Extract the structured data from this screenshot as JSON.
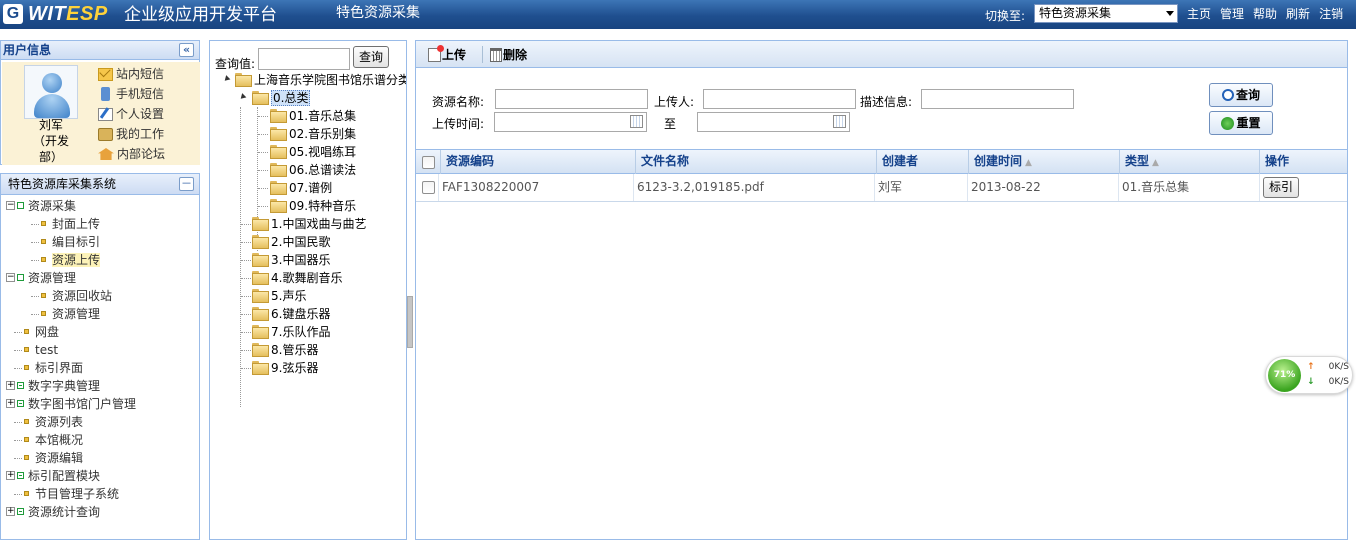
{
  "header": {
    "logo_letter": "G",
    "brand_part1": "WIT",
    "brand_part2": "ESP",
    "app_title": "企业级应用开发平台",
    "module_title": "特色资源采集",
    "switch_label": "切换至:",
    "switch_value": "特色资源采集",
    "nav": [
      "主页",
      "管理",
      "帮助",
      "刷新",
      "注销"
    ]
  },
  "user_panel": {
    "title": "用户信息",
    "collapse_icon": "«",
    "user_name": "刘军",
    "user_dept_line1": "（开发",
    "user_dept_line2": "部）",
    "menu": [
      {
        "label": "站内短信",
        "icon": "mail-icon"
      },
      {
        "label": "手机短信",
        "icon": "phone-icon"
      },
      {
        "label": "个人设置",
        "icon": "edit-icon"
      },
      {
        "label": "我的工作",
        "icon": "work-icon"
      },
      {
        "label": "内部论坛",
        "icon": "forum-icon"
      }
    ]
  },
  "nav_panel": {
    "title": "特色资源库采集系统",
    "collapse_icon": "－",
    "items": [
      {
        "label": "资源采集",
        "level": 0,
        "toggle": "−",
        "selected": false
      },
      {
        "label": "封面上传",
        "level": 1,
        "selected": false
      },
      {
        "label": "编目标引",
        "level": 1,
        "selected": false
      },
      {
        "label": "资源上传",
        "level": 1,
        "selected": true
      },
      {
        "label": "资源管理",
        "level": 0,
        "toggle": "−",
        "selected": false
      },
      {
        "label": "资源回收站",
        "level": 1,
        "selected": false
      },
      {
        "label": "资源管理",
        "level": 1,
        "selected": false
      },
      {
        "label": "网盘",
        "level": 0,
        "selected": false
      },
      {
        "label": "test",
        "level": 0,
        "selected": false
      },
      {
        "label": "标引界面",
        "level": 0,
        "selected": false
      },
      {
        "label": "数字字典管理",
        "level": 0,
        "toggle": "+",
        "selected": false
      },
      {
        "label": "数字图书馆门户管理",
        "level": 0,
        "toggle": "+",
        "selected": false
      },
      {
        "label": "资源列表",
        "level": 0,
        "selected": false
      },
      {
        "label": "本馆概况",
        "level": 0,
        "selected": false
      },
      {
        "label": "资源编辑",
        "level": 0,
        "selected": false
      },
      {
        "label": "标引配置模块",
        "level": 0,
        "toggle": "+",
        "selected": false
      },
      {
        "label": "节目管理子系统",
        "level": 0,
        "selected": false
      },
      {
        "label": "资源统计查询",
        "level": 0,
        "toggle": "+",
        "selected": false
      }
    ]
  },
  "category_tree": {
    "query_label": "查询值:",
    "query_value": "",
    "query_button": "查询",
    "root": "上海音乐学院图书馆乐谱分类",
    "selected": "0.总类",
    "children_of_selected": [
      "01.音乐总集",
      "02.音乐别集",
      "05.视唱练耳",
      "06.总谱读法",
      "07.谱例",
      "09.特种音乐"
    ],
    "siblings": [
      "1.中国戏曲与曲艺",
      "2.中国民歌",
      "3.中国器乐",
      "4.歌舞剧音乐",
      "5.声乐",
      "6.键盘乐器",
      "7.乐队作品",
      "8.管乐器",
      "9.弦乐器"
    ]
  },
  "toolbar": {
    "upload_label": "上传",
    "delete_label": "删除"
  },
  "search_form": {
    "resource_name_label": "资源名称:",
    "resource_name_value": "",
    "uploader_label": "上传人:",
    "uploader_value": "",
    "description_label": "描述信息:",
    "description_value": "",
    "upload_time_label": "上传时间:",
    "upload_time_from": "",
    "to_label": "至",
    "upload_time_to": "",
    "query_button": "查询",
    "reset_button": "重置"
  },
  "grid": {
    "columns": [
      "资源编码",
      "文件名称",
      "创建者",
      "创建时间",
      "类型",
      "操作"
    ],
    "rows": [
      {
        "code": "FAF1308220007",
        "file_name": "6123-3.2,019185.pdf",
        "creator": "刘军",
        "created": "2013-08-22",
        "type": "01.音乐总集",
        "action": "标引"
      }
    ]
  },
  "speed_widget": {
    "percent": "71%",
    "up_speed": "0K/S",
    "down_speed": "0K/S"
  }
}
